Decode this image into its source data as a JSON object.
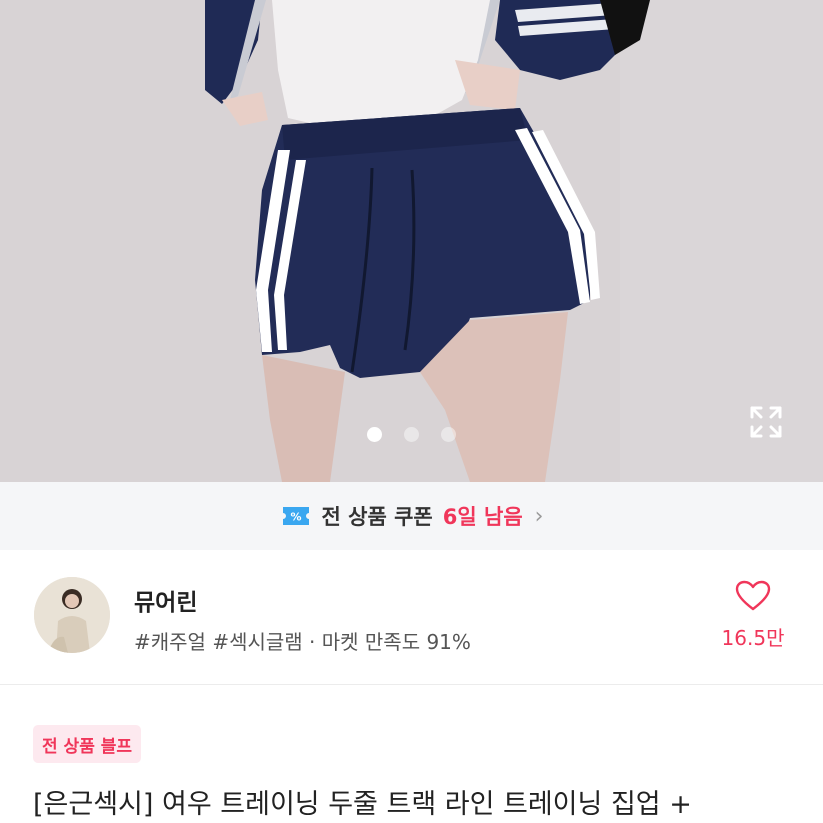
{
  "gallery": {
    "image_alt": "product photo",
    "dots_total": 3,
    "active_dot": 1
  },
  "coupon": {
    "text": "전 상품 쿠폰",
    "count": "6일 남음",
    "icon": "coupon-ticket-icon",
    "chevron": "›"
  },
  "seller": {
    "name": "뮤어린",
    "tags": "#캐주얼 #섹시글램 · 마켓 만족도 91%",
    "like_count": "16.5만"
  },
  "product": {
    "badge": "전 상품 블프",
    "title": "[은근섹시] 여우 트레이닝 두줄 트랙 라인 트레이닝 집업 +"
  },
  "colors": {
    "accent": "#f0365a",
    "coupon_icon": "#3aa7f0",
    "navy": "#1f2a55"
  }
}
